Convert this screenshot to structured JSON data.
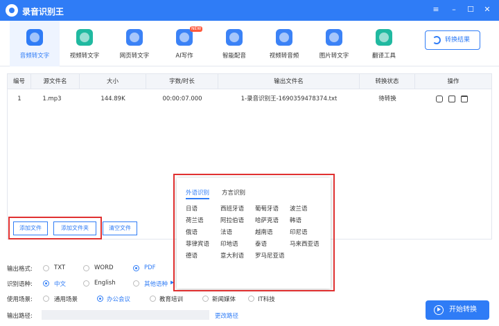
{
  "app": {
    "title": "录音识别王"
  },
  "colors": {
    "accent": "#2f7cf6",
    "highlight_box": "#e03030"
  },
  "toolbar": {
    "items": [
      {
        "label": "音频转文字",
        "icon": "audio-to-text-icon",
        "color": "#2f7cf6"
      },
      {
        "label": "视频转文字",
        "icon": "video-to-text-icon",
        "color": "#20b9a0"
      },
      {
        "label": "网页转文字",
        "icon": "webpage-to-text-icon",
        "color": "#3b82f6"
      },
      {
        "label": "AI写作",
        "icon": "ai-writing-icon",
        "color": "#3b82f6"
      },
      {
        "label": "智能配音",
        "icon": "dubbing-icon",
        "color": "#3b82f6"
      },
      {
        "label": "视频转音频",
        "icon": "video-to-audio-icon",
        "color": "#3b82f6"
      },
      {
        "label": "图片转文字",
        "icon": "image-to-text-icon",
        "color": "#3b82f6"
      },
      {
        "label": "翻译工具",
        "icon": "translate-icon",
        "color": "#20b9a0"
      }
    ],
    "new_badge": "NEW",
    "result_button": "转换结果"
  },
  "table": {
    "headers": [
      "编号",
      "源文件名",
      "大小",
      "字数/时长",
      "输出文件名",
      "转换状态",
      "操作"
    ],
    "rows": [
      {
        "index": "1",
        "name": "1.mp3",
        "size": "144.89K",
        "duration": "00:00:07.000",
        "output": "1-录音识别王-1690359478374.txt",
        "status": "待转换"
      }
    ]
  },
  "buttons": {
    "add_file": "添加文件",
    "add_folder": "添加文件夹",
    "clear_files": "清空文件"
  },
  "popup": {
    "tabs": [
      "外语识别",
      "方言识别"
    ],
    "languages": [
      "日语",
      "西班牙语",
      "葡萄牙语",
      "波兰语",
      "荷兰语",
      "阿拉伯语",
      "哈萨克语",
      "韩语",
      "俄语",
      "法语",
      "越南语",
      "印尼语",
      "菲律宾语",
      "印地语",
      "泰语",
      "马来西亚语",
      "德语",
      "意大利语",
      "罗马尼亚语"
    ]
  },
  "options": {
    "format": {
      "label": "输出格式:",
      "choices": [
        "TXT",
        "WORD",
        "PDF"
      ],
      "selected": 2
    },
    "language": {
      "label": "识别语种:",
      "choices": [
        "中文",
        "English",
        "其他语种"
      ],
      "selected": 0
    },
    "scene": {
      "label": "使用场景:",
      "choices": [
        "通用场景",
        "办公会议",
        "教育培训",
        "新闻媒体",
        "IT科技"
      ],
      "selected": 1
    },
    "path": {
      "label": "输出路径:",
      "change": "更改路径"
    }
  },
  "start_button": "开始转换"
}
